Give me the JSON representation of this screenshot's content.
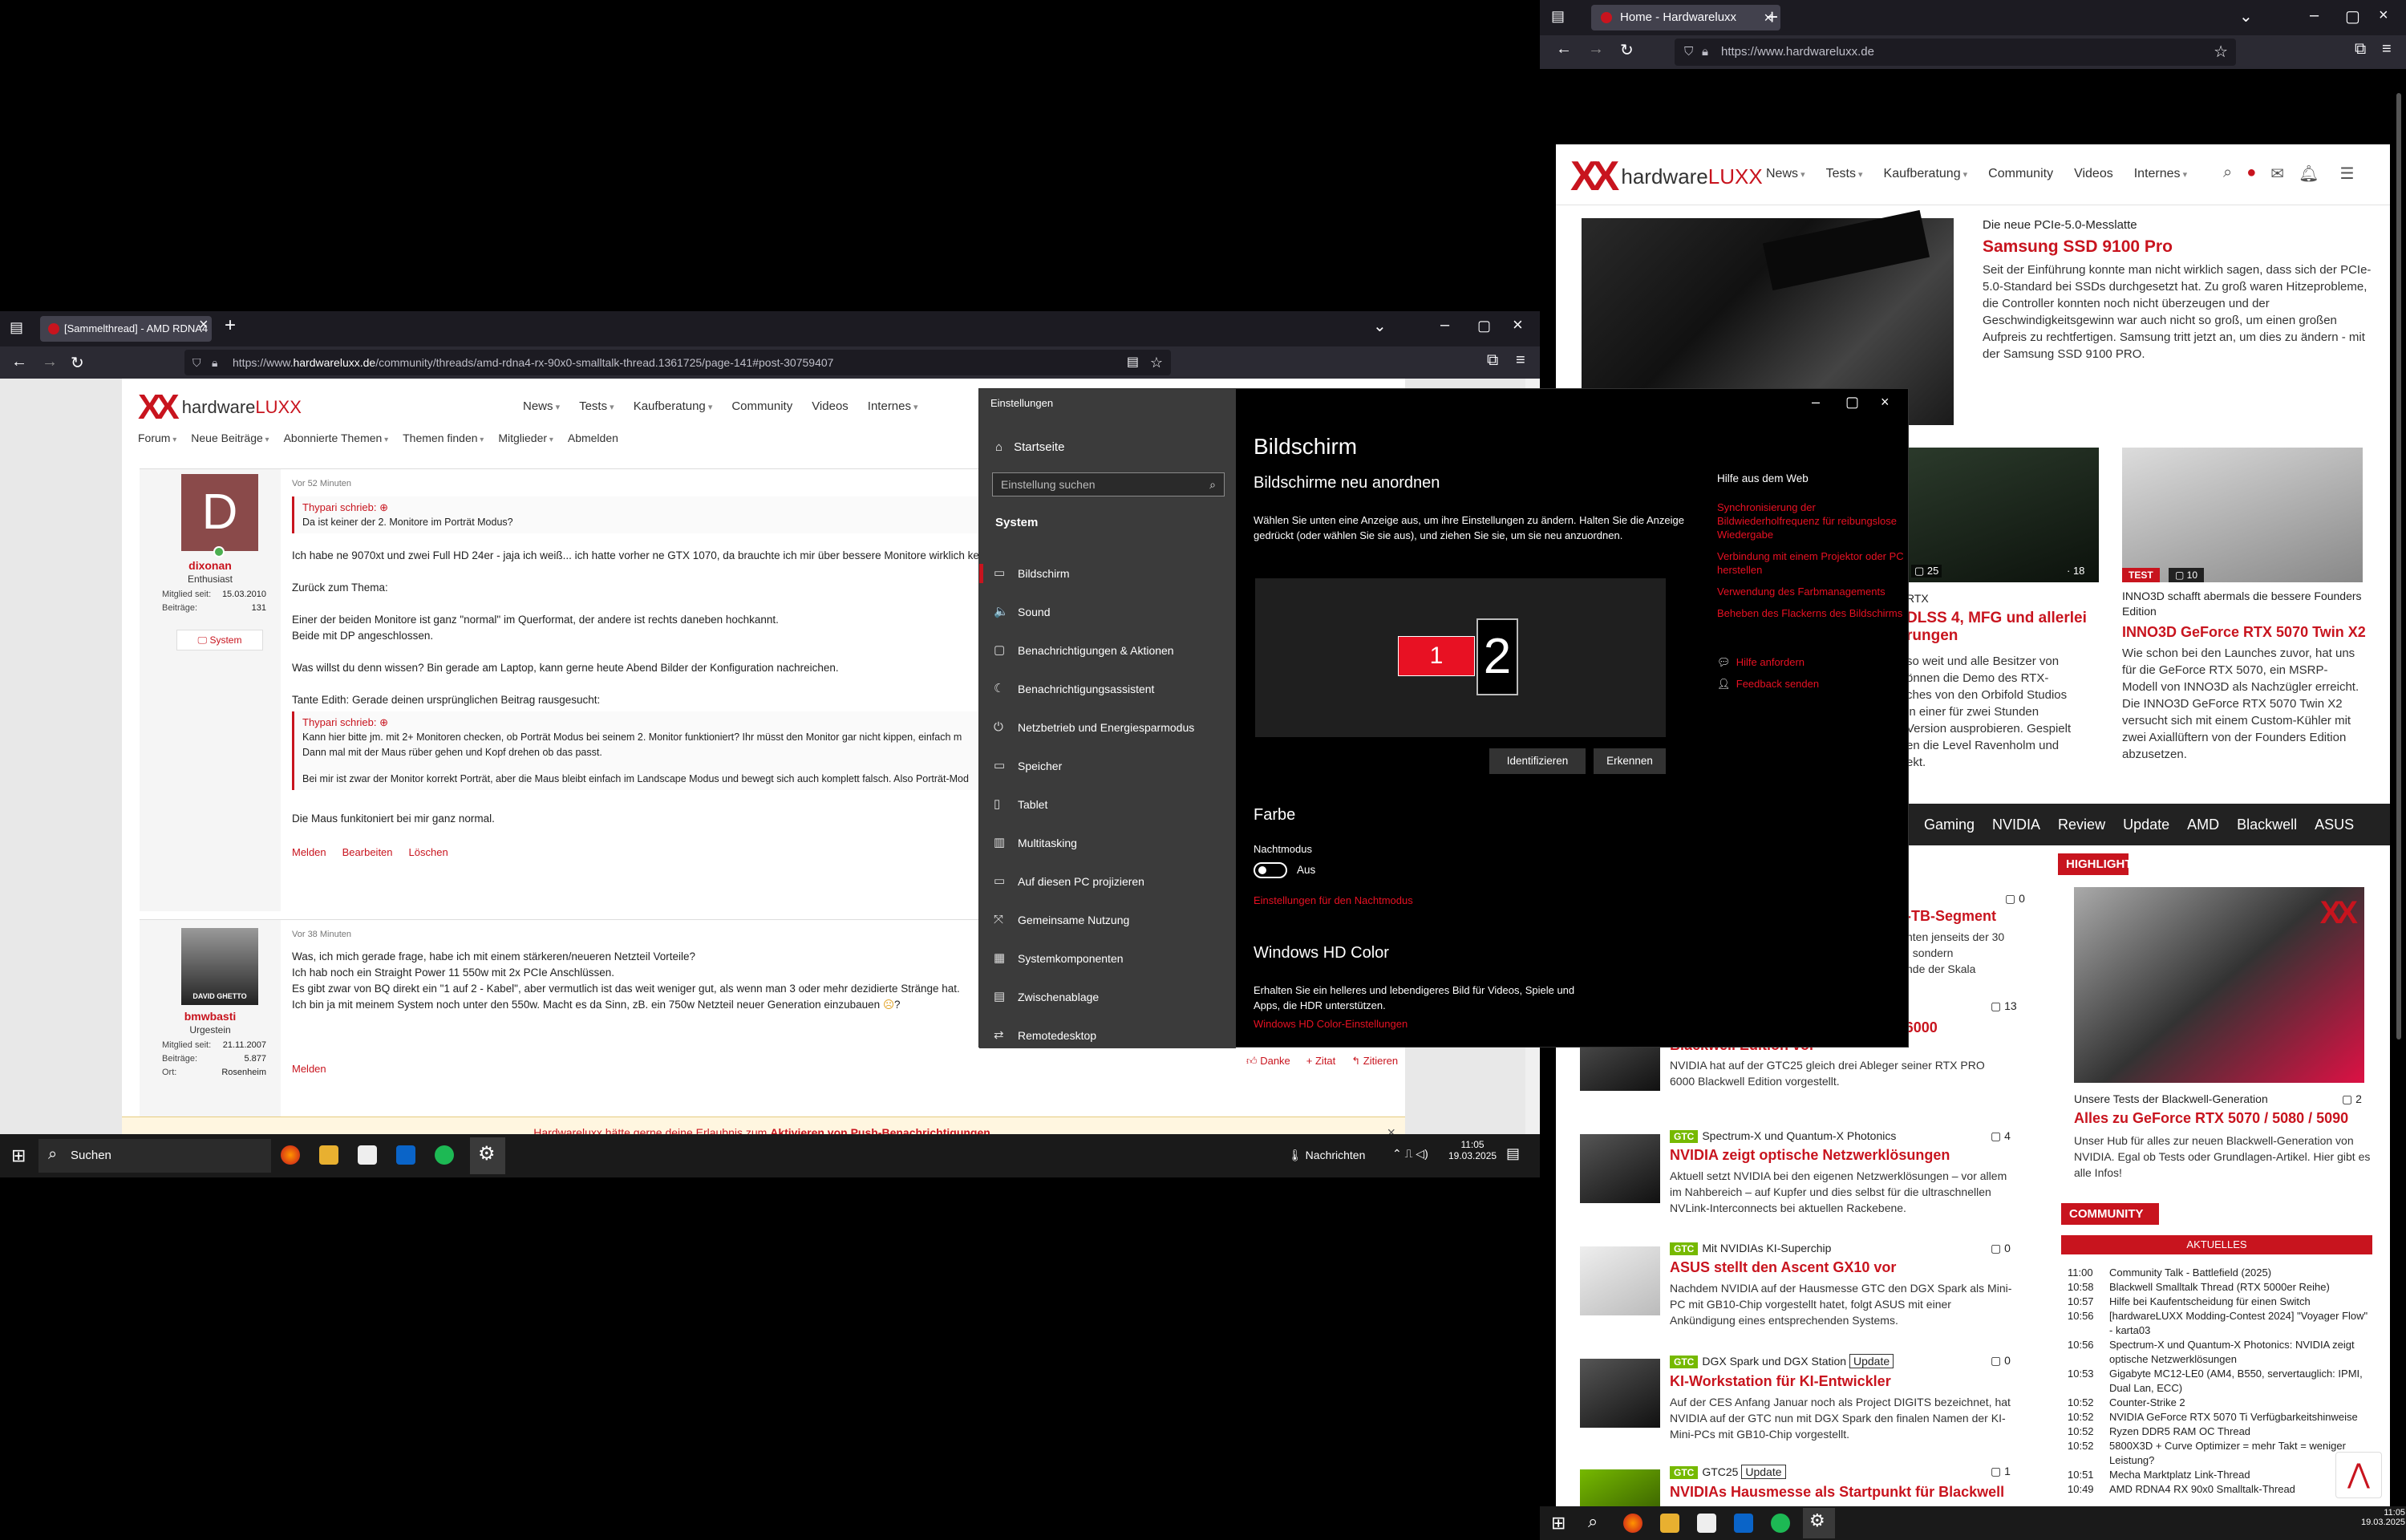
{
  "right_browser": {
    "tab_title": "Home - Hardwareluxx",
    "url": "https://www.hardwareluxx.de",
    "logo_text": "hardware",
    "logo_accent": "LUXX",
    "menu": [
      "News",
      "Tests",
      "Kaufberatung",
      "Community",
      "Videos",
      "Internes"
    ],
    "featured": {
      "kicker": "Die neue PCIe-5.0-Messlatte",
      "title": "Samsung SSD 9100 Pro",
      "text": "Seit der Einführung konnte man nicht wirklich sagen, dass sich der PCIe-5.0-Standard bei SSDs durchgesetzt hat. Zu groß waren Hitzeprobleme, die Controller konnten noch nicht überzeugen und der Geschwindigkeitsgewinn war auch nicht so groß, um einen großen Aufpreis zu rechtfertigen. Samsung tritt jetzt an, um dies zu ändern - mit der Samsung SSD 9100 PRO."
    },
    "card_mid": {
      "comments": "25",
      "views": "18",
      "kicker_frag": "RTX",
      "title": "DLSS 4, MFG und allerlei\nrungen",
      "text": "so weit und alle Besitzer von\nönnen die Demo des RTX-\nches von den Orbifold Studios\nin einer für zwei Stunden\nVersion ausprobieren. Gespielt\nen die Level Ravenholm und\nekt."
    },
    "card_right": {
      "badge": "TEST",
      "comments": "10",
      "kicker": "INNO3D schafft abermals die bessere Founders Edition",
      "title": "INNO3D GeForce RTX 5070 Twin X2",
      "text": "Wie schon bei den Launches zuvor, hat uns für die GeForce RTX 5070, ein MSRP-Modell von INNO3D als Nachzügler erreicht. Die INNO3D GeForce RTX 5070 Twin X2 versucht sich mit einem Custom-Kühler mit zwei Axiallüftern von der Founders Edition abzusetzen."
    },
    "tags": [
      "Gaming",
      "NVIDIA",
      "Review",
      "Update",
      "AMD",
      "Blackwell",
      "ASUS"
    ],
    "frag_tb": "-TB-Segment",
    "frag_tb_text": "nten jenseits der 30\n, sondern\nnde der Skala",
    "frag_count_0": "0",
    "news": [
      {
        "kicker": "",
        "title": "NVIDIA stellt die NVIDIA RTX PRO 6000 Blackwell Edition vor",
        "text": "NVIDIA hat auf der GTC25 gleich drei Ableger seiner RTX PRO 6000 Blackwell Edition vorgestellt.",
        "comments": "13",
        "gtc": false,
        "update": false
      },
      {
        "kicker": "Spectrum-X und Quantum-X Photonics",
        "title": "NVIDIA zeigt optische Netzwerklösungen",
        "text": "Aktuell setzt NVIDIA bei den eigenen Netzwerklösungen – vor allem im Nahbereich – auf Kupfer und dies selbst für die ultraschnellen NVLink-Interconnects bei aktuellen Rackebene.",
        "comments": "4",
        "gtc": true,
        "update": false
      },
      {
        "kicker": "Mit NVIDIAs KI-Superchip",
        "title": "ASUS stellt den Ascent GX10 vor",
        "text": "Nachdem NVIDIA auf der Hausmesse GTC den DGX Spark als Mini-PC mit GB10-Chip vorgestellt hatet, folgt ASUS mit einer Ankündigung eines entsprechenden Systems.",
        "comments": "0",
        "gtc": true,
        "update": false
      },
      {
        "kicker": "DGX Spark und DGX Station",
        "title": "KI-Workstation für KI-Entwickler",
        "text": "Auf der CES Anfang Januar noch als Project DIGITS bezeichnet, hat NVIDIA auf der GTC nun mit DGX Spark den finalen Namen der KI-Mini-PCs mit GB10-Chip vorgestellt.",
        "comments": "0",
        "gtc": true,
        "update": true
      },
      {
        "kicker": "GTC25",
        "title": "NVIDIAs Hausmesse als Startpunkt für Blackwell",
        "text": "",
        "comments": "1",
        "gtc": true,
        "update": true
      }
    ],
    "gtc_label": "GTC",
    "update_label": "Update",
    "highlight": {
      "header": "HIGHLIGHT",
      "caption": "Unsere Tests der Blackwell-Generation",
      "comments": "2",
      "title": "Alles zu GeForce RTX 5070 / 5080 / 5090",
      "text": "Unser Hub für alles zur neuen Blackwell-Generation von NVIDIA. Egal ob Tests oder Grundlagen-Artikel. Hier gibt es alle Infos!"
    },
    "community": {
      "header": "COMMUNITY",
      "sub": "AKTUELLES",
      "items": [
        {
          "t": "11:00",
          "s": "Community Talk - Battlefield (2025)"
        },
        {
          "t": "10:58",
          "s": "Blackwell Smalltalk Thread (RTX 5000er Reihe)"
        },
        {
          "t": "10:57",
          "s": "Hilfe bei Kaufentscheidung für einen Switch"
        },
        {
          "t": "10:56",
          "s": "[hardwareLUXX Modding-Contest 2024] \"Voyager Flow\" - karta03"
        },
        {
          "t": "10:56",
          "s": "Spectrum-X und Quantum-X Photonics: NVIDIA zeigt optische Netzwerklösungen"
        },
        {
          "t": "10:53",
          "s": "Gigabyte MC12-LE0 (AM4, B550, servertauglich: IPMI, Dual Lan, ECC)"
        },
        {
          "t": "10:52",
          "s": "Counter-Strike 2"
        },
        {
          "t": "10:52",
          "s": "NVIDIA GeForce RTX 5070 Ti Verfügbarkeitshinweise"
        },
        {
          "t": "10:52",
          "s": "Ryzen DDR5 RAM OC Thread"
        },
        {
          "t": "10:52",
          "s": "5800X3D + Curve Optimizer = mehr Takt = weniger Leistung?"
        },
        {
          "t": "10:51",
          "s": "Mecha Marktplatz Link-Thread"
        },
        {
          "t": "10:49",
          "s": "AMD RDNA4 RX 90x0 Smalltalk-Thread"
        }
      ]
    }
  },
  "left_browser": {
    "tab_title": "[Sammelthread] - AMD RDNA4",
    "url_pre": "https://www.",
    "url_host": "hardwareluxx.de",
    "url_path": "/community/threads/amd-rdna4-rx-90x0-smalltalk-thread.1361725/page-141#post-30759407",
    "menu": [
      "News",
      "Tests",
      "Kaufberatung",
      "Community",
      "Videos",
      "Internes"
    ],
    "forum_nav": [
      "Forum",
      "Neue Beiträge",
      "Abonnierte Themen",
      "Themen finden",
      "Mitglieder"
    ],
    "logout": "Abmelden",
    "post1": {
      "initial": "D",
      "username": "dixonan",
      "rank": "Enthusiast",
      "meta": [
        {
          "k": "Mitglied seit:",
          "v": "15.03.2010"
        },
        {
          "k": "Beiträge:",
          "v": "131"
        }
      ],
      "system_btn": "System",
      "time": "Vor 52 Minuten",
      "quote1_author": "Thypari schrieb:",
      "quote1_text": "Da ist keiner der 2. Monitore im Porträt Modus?",
      "line1": "Ich habe ne 9070xt und zwei Full HD 24er - jaja ich weiß... ich hatte vorher ne GTX 1070, da brauchte ich mir über bessere Monitore wirklich kei",
      "line2": "Zurück zum Thema:",
      "line3": "Einer der beiden Monitore ist ganz \"normal\" im Querformat, der andere ist rechts daneben hochkannt.",
      "line4": "Beide mit DP angeschlossen.",
      "line5": "Was willst du denn wissen? Bin gerade am Laptop, kann gerne heute Abend Bilder der Konfiguration nachreichen.",
      "line6": "Tante Edith: Gerade deinen ursprünglichen Beitrag rausgesucht:",
      "quote2_author": "Thypari schrieb:",
      "quote2_text1": "Kann hier bitte jm. mit 2+ Monitoren checken, ob Porträt Modus bei seinem 2. Monitor funktioniert? Ihr müsst den Monitor gar nicht kippen, einfach m",
      "quote2_text2": "Dann mal mit der Maus rüber gehen und Kopf drehen ob das passt.",
      "quote2_text3": "Bei mir ist zwar der Monitor korrekt Porträt, aber die Maus bleibt einfach im Landscape Modus und bewegt sich auch komplett falsch. Also Porträt-Mod",
      "line7": "Die Maus funkitoniert bei mir ganz normal.",
      "links": [
        "Melden",
        "Bearbeiten",
        "Löschen"
      ]
    },
    "post2": {
      "username": "bmwbasti",
      "rank": "Urgestein",
      "avatar_caption": "DAVID GHETTO",
      "meta": [
        {
          "k": "Mitglied seit:",
          "v": "21.11.2007"
        },
        {
          "k": "Beiträge:",
          "v": "5.877"
        },
        {
          "k": "Ort:",
          "v": "Rosenheim"
        }
      ],
      "time": "Vor 38 Minuten",
      "line1": "Was, ich mich gerade frage, habe ich mit einem stärkeren/neueren Netzteil Vorteile?",
      "line2": "Ich hab noch ein Straight Power 11 550w mit 2x PCIe Anschlüssen.",
      "line3": "Es gibt zwar von BQ direkt ein \"1 auf 2 - Kabel\", aber vermutlich ist das weit weniger gut, als wenn man 3 oder mehr dezidierte Stränge hat.",
      "line4": "Ich bin ja mit meinem System noch unter den 550w. Macht es da Sinn, zB. ein 750w Netzteil neuer Generation einzubauen",
      "report": "Melden",
      "actions": [
        "Danke",
        "+ Zitat",
        "Zitieren"
      ]
    },
    "consent_pre": "Hardwareluxx hätte gerne deine Erlaubnis zum ",
    "consent_link": "Aktivieren von Push-Benachrichtigungen",
    "consent_post": "."
  },
  "settings": {
    "app_title": "Einstellungen",
    "home": "Startseite",
    "search_placeholder": "Einstellung suchen",
    "category": "System",
    "nav": [
      {
        "label": "Bildschirm",
        "icon": "monitor-icon",
        "glyph": "▭"
      },
      {
        "label": "Sound",
        "icon": "speaker-icon",
        "glyph": "🔈"
      },
      {
        "label": "Benachrichtigungen & Aktionen",
        "icon": "notification-icon",
        "glyph": "▢"
      },
      {
        "label": "Benachrichtigungsassistent",
        "icon": "moon-icon",
        "glyph": "☾"
      },
      {
        "label": "Netzbetrieb und Energiesparmodus",
        "icon": "power-icon",
        "glyph": "⏻"
      },
      {
        "label": "Speicher",
        "icon": "storage-icon",
        "glyph": "▭"
      },
      {
        "label": "Tablet",
        "icon": "tablet-icon",
        "glyph": "▯"
      },
      {
        "label": "Multitasking",
        "icon": "multitasking-icon",
        "glyph": "▥"
      },
      {
        "label": "Auf diesen PC projizieren",
        "icon": "project-icon",
        "glyph": "▭"
      },
      {
        "label": "Gemeinsame Nutzung",
        "icon": "share-icon",
        "glyph": "⤧"
      },
      {
        "label": "Systemkomponenten",
        "icon": "components-icon",
        "glyph": "▦"
      },
      {
        "label": "Zwischenablage",
        "icon": "clipboard-icon",
        "glyph": "▤"
      },
      {
        "label": "Remotedesktop",
        "icon": "remote-icon",
        "glyph": "⇄"
      }
    ],
    "title": "Bildschirm",
    "rearrange_title": "Bildschirme neu anordnen",
    "rearrange_desc": "Wählen Sie unten eine Anzeige aus, um ihre Einstellungen zu ändern. Halten Sie die Anzeige gedrückt (oder wählen Sie sie aus), und ziehen Sie sie, um sie neu anzuordnen.",
    "monitor1": "1",
    "monitor2": "2",
    "identify": "Identifizieren",
    "detect": "Erkennen",
    "color_title": "Farbe",
    "night_label": "Nachtmodus",
    "night_state": "Aus",
    "night_link": "Einstellungen für den Nachtmodus",
    "hdr_title": "Windows HD Color",
    "hdr_desc": "Erhalten Sie ein helleres und lebendigeres Bild für Videos, Spiele und Apps, die HDR unterstützen.",
    "hdr_link": "Windows HD Color-Einstellungen",
    "help_title": "Hilfe aus dem Web",
    "help_links": [
      "Synchronisierung der Bildwiederholfrequenz für reibungslose Wiedergabe",
      "Verbindung mit einem Projektor oder PC herstellen",
      "Verwendung des Farbmanagements",
      "Beheben des Flackerns des Bildschirms"
    ],
    "get_help": "Hilfe anfordern",
    "feedback": "Feedback senden"
  },
  "taskbar_left": {
    "search": "Suchen",
    "news": "Nachrichten",
    "time": "11:05",
    "date": "19.03.2025"
  },
  "taskbar_right": {
    "time": "11:05",
    "date": "19.03.2025"
  },
  "colors": {
    "accent": "#c8141e",
    "nvidia": "#76b900"
  }
}
